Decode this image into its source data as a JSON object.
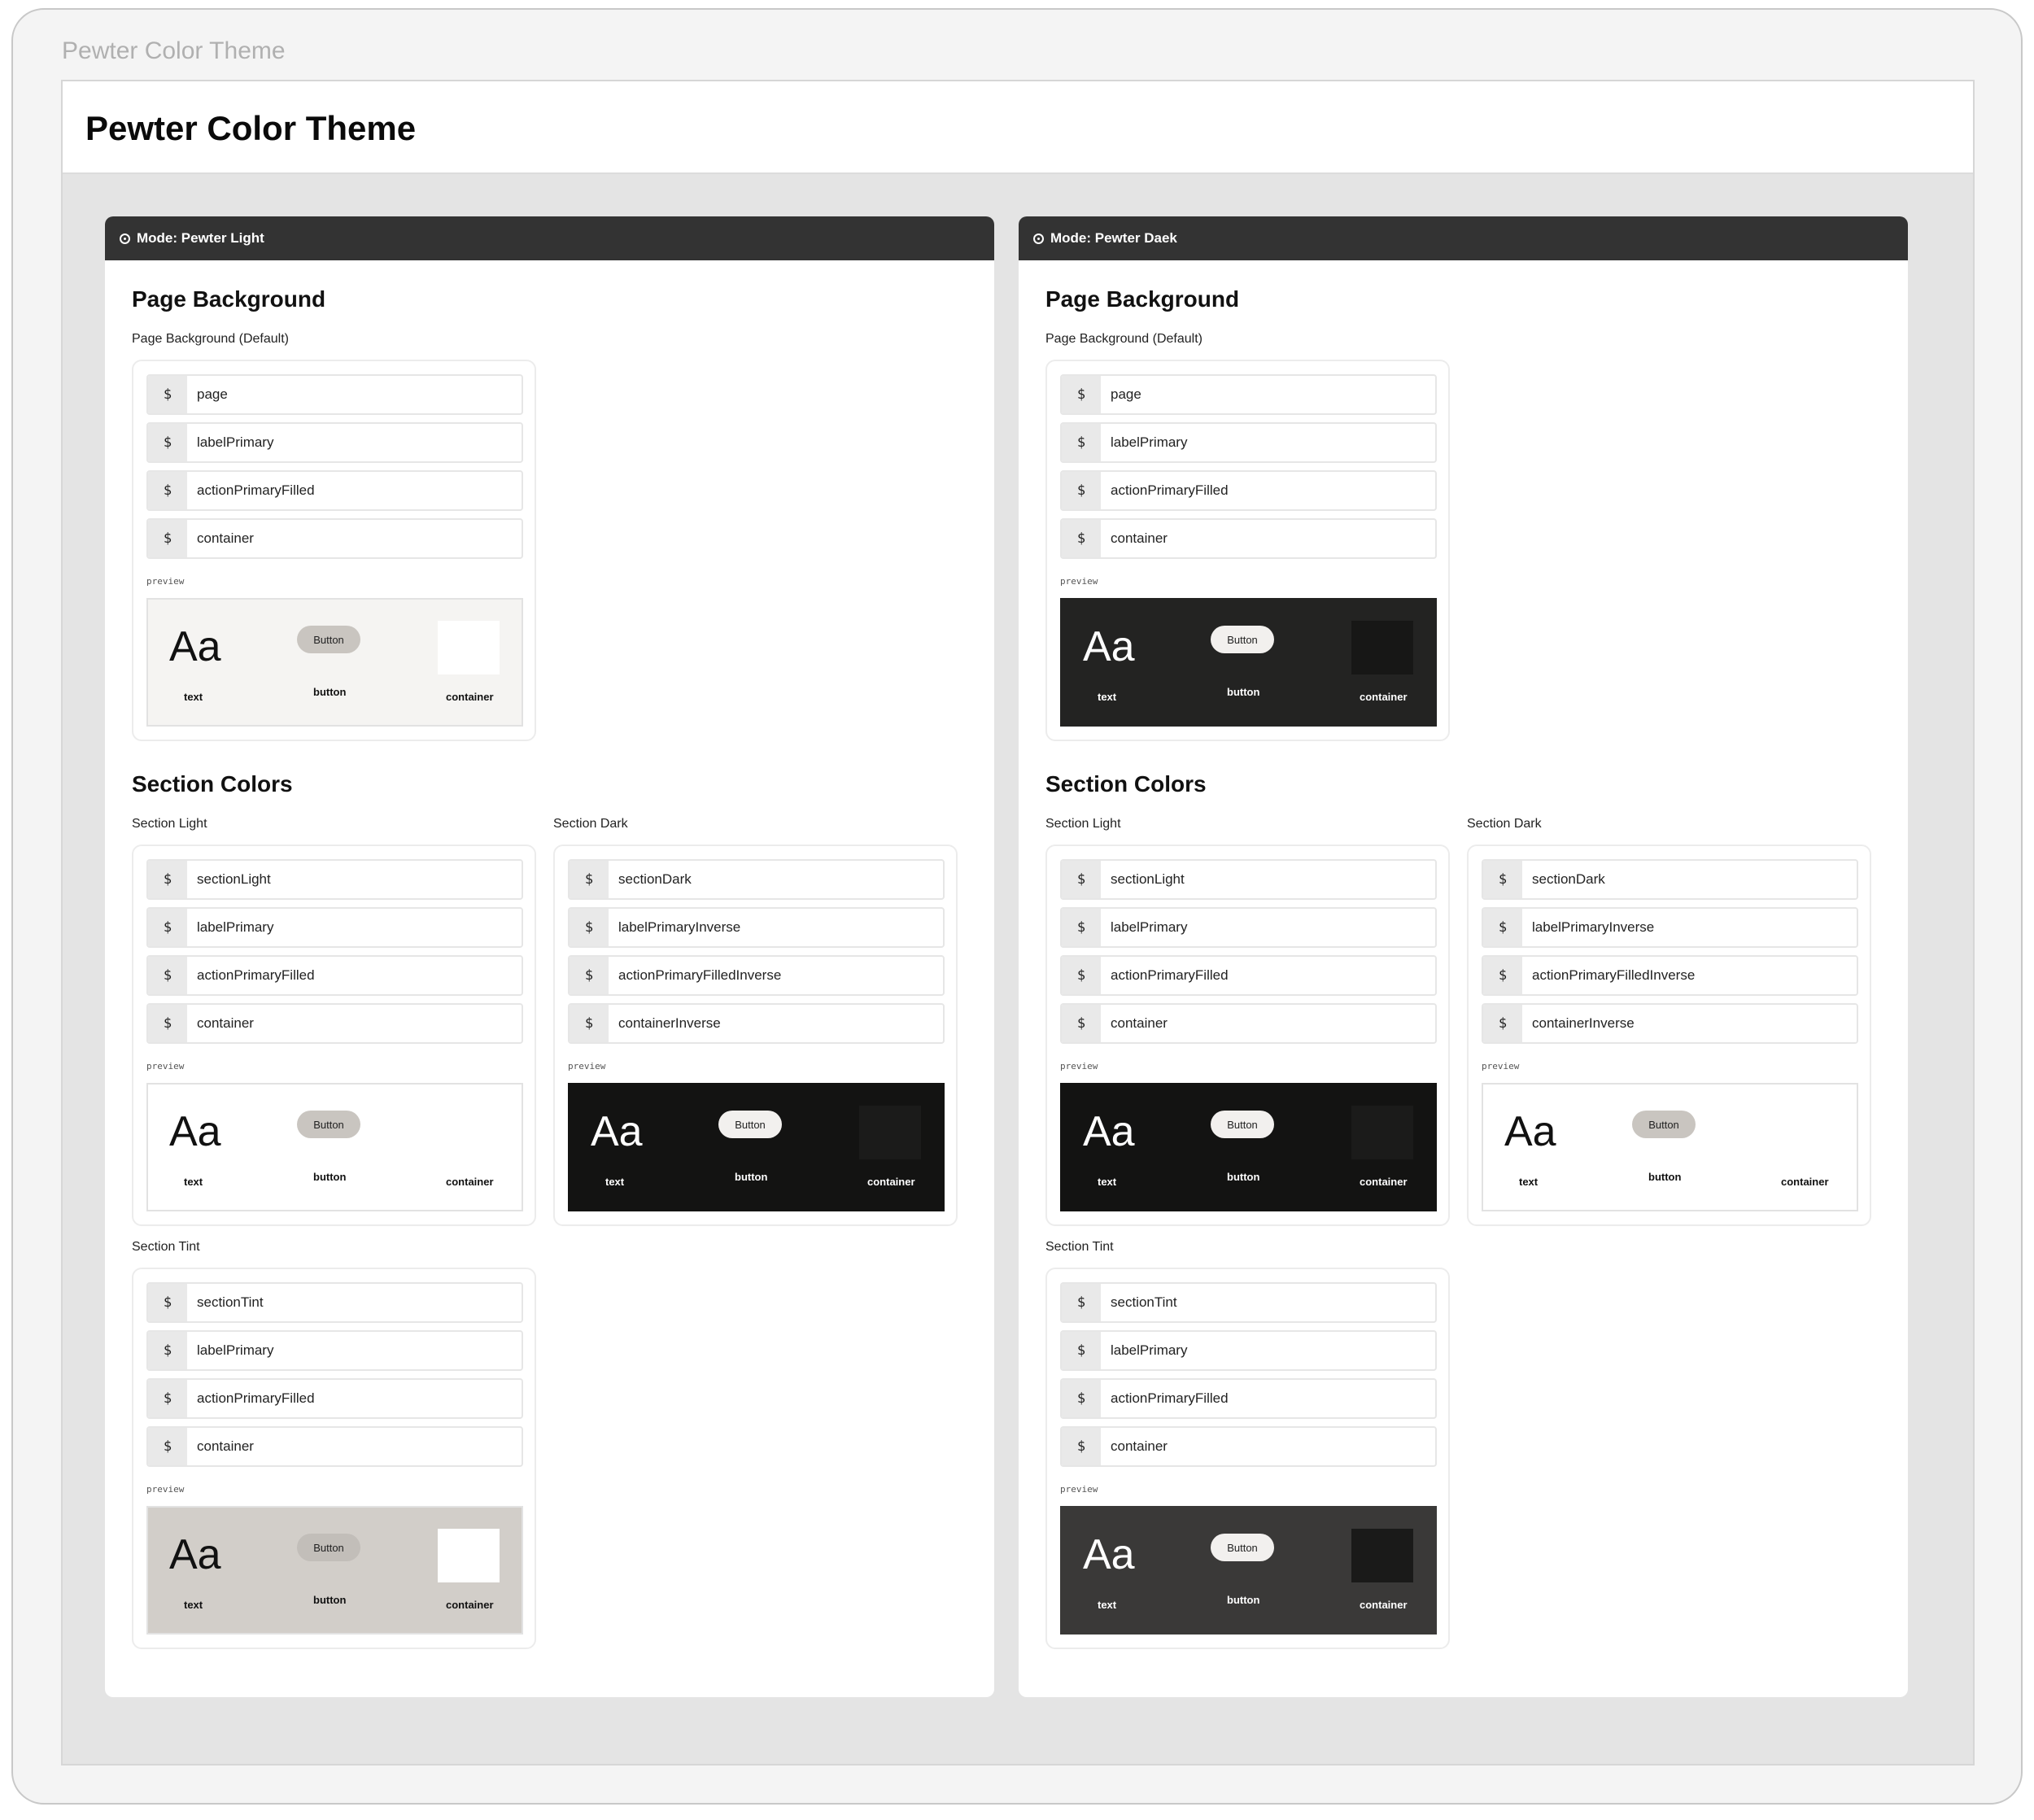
{
  "window": {
    "title": "Pewter Color Theme"
  },
  "page": {
    "title": "Pewter Color Theme"
  },
  "modes": [
    {
      "title": "Mode: Pewter Light",
      "page_background": {
        "heading": "Page Background",
        "label": "Page Background (Default)",
        "tokens": [
          "page",
          "labelPrimary",
          "actionPrimaryFilled",
          "container"
        ]
      },
      "section_colors": {
        "heading": "Section Colors",
        "light": {
          "label": "Section Light",
          "tokens": [
            "sectionLight",
            "labelPrimary",
            "actionPrimaryFilled",
            "container"
          ]
        },
        "dark": {
          "label": "Section Dark",
          "tokens": [
            "sectionDark",
            "labelPrimaryInverse",
            "actionPrimaryFilledInverse",
            "containerInverse"
          ]
        },
        "tint": {
          "label": "Section Tint",
          "tokens": [
            "sectionTint",
            "labelPrimary",
            "actionPrimaryFilled",
            "container"
          ]
        }
      }
    },
    {
      "title": "Mode: Pewter Daek",
      "page_background": {
        "heading": "Page Background",
        "label": "Page Background (Default)",
        "tokens": [
          "page",
          "labelPrimary",
          "actionPrimaryFilled",
          "container"
        ]
      },
      "section_colors": {
        "heading": "Section Colors",
        "light": {
          "label": "Section Light",
          "tokens": [
            "sectionLight",
            "labelPrimary",
            "actionPrimaryFilled",
            "container"
          ]
        },
        "dark": {
          "label": "Section Dark",
          "tokens": [
            "sectionDark",
            "labelPrimaryInverse",
            "actionPrimaryFilledInverse",
            "containerInverse"
          ]
        },
        "tint": {
          "label": "Section Tint",
          "tokens": [
            "sectionTint",
            "labelPrimary",
            "actionPrimaryFilled",
            "container"
          ]
        }
      }
    }
  ],
  "token_prefix": "$",
  "preview": {
    "label": "preview",
    "sample_text": "Aa",
    "text_label": "text",
    "button_text": "Button",
    "button_label": "button",
    "container_label": "container"
  },
  "icons": {
    "mode": "target-icon"
  },
  "colors": {
    "mode_bar": "#333333",
    "canvas": "#e4e4e4",
    "pewter_button": "#c9c5c0",
    "tint": "#d2cec9",
    "section_dark": "#131312"
  }
}
